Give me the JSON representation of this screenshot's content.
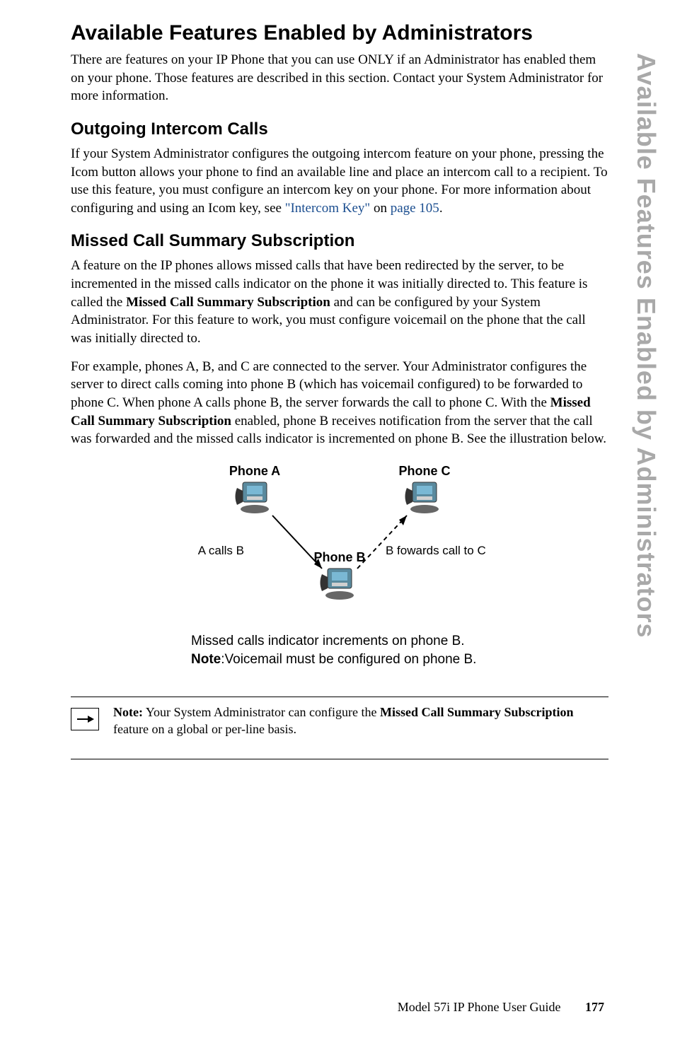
{
  "sideTab": "Available Features Enabled by Administrators",
  "heading1": "Available Features Enabled by Administrators",
  "intro": "There are features on your IP Phone that you can use ONLY if an Administrator has enabled them on your phone. Those features are described in this section. Contact your System Administrator for more information.",
  "heading2": "Outgoing Intercom Calls",
  "para2a": "If your System Administrator configures the outgoing intercom feature on your phone, pressing the Icom button allows your phone to find an available line and place an intercom call to a recipient. To use this feature, you must configure an intercom key on your phone. For more information about configuring and using an Icom key, see ",
  "link2a": "\"Intercom Key\"",
  "para2b": " on ",
  "link2b": "page 105",
  "para2c": ".",
  "heading3": "Missed Call Summary Subscription",
  "para3a": "A feature on the IP phones allows missed calls that have been redirected by the server, to be incremented in the missed calls indicator on the phone it was initially directed to. This feature is called the ",
  "bold3a": "Missed Call Summary Subscription",
  "para3b": " and can be configured by your System Administrator. For this feature to work, you must configure voicemail on the phone that the call was initially directed to.",
  "para4a": "For example, phones A, B, and C are connected to the server. Your Administrator configures the server to direct calls coming into phone B (which has voicemail configured) to be forwarded to phone C. When phone A calls phone B, the server forwards the call to phone C. With the ",
  "bold4a": "Missed Call Summary Subscription",
  "para4b": " enabled, phone B receives notification from the server that the call was forwarded and the missed calls indicator is incremented on phone B. See the illustration below.",
  "diagram": {
    "phoneA": "Phone A",
    "phoneB": "Phone B",
    "phoneC": "Phone C",
    "labelLeft": "A calls B",
    "labelRight": "B fowards call to C",
    "caption1": "Missed calls indicator increments on phone B.",
    "captionNoteLabel": "Note",
    "caption2": ":Voicemail must be configured on phone B."
  },
  "note": {
    "label": "Note:",
    "text1": " Your System Administrator can configure the ",
    "bold": "Missed Call Summary Subscription",
    "text2": " feature on a global or per-line basis."
  },
  "footer": {
    "guide": "Model 57i IP Phone User Guide",
    "page": "177"
  }
}
